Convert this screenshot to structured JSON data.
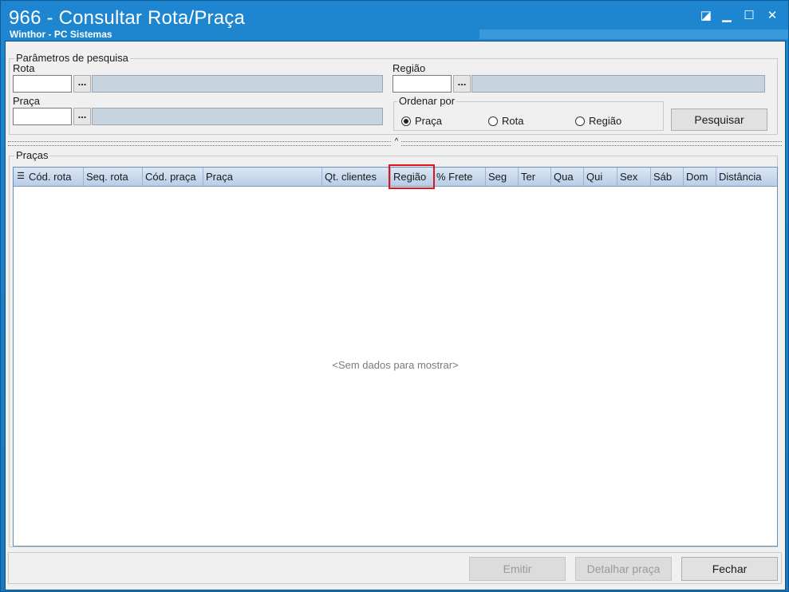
{
  "window": {
    "title": "966 - Consultar Rota/Praça",
    "subtitle": "Winthor - PC Sistemas",
    "controls": {
      "restore": "◪",
      "minimize": "▁",
      "maximize": "☐",
      "close": "✕"
    }
  },
  "search": {
    "group_title": "Parâmetros de pesquisa",
    "rota_label": "Rota",
    "rota_value": "",
    "praca_label": "Praça",
    "praca_value": "",
    "regiao_label": "Região",
    "regiao_value": "",
    "dots": "...",
    "order_title": "Ordenar por",
    "order_options": [
      "Praça",
      "Rota",
      "Região"
    ],
    "order_selected": "Praça",
    "search_button": "Pesquisar"
  },
  "grid": {
    "group_title": "Praças",
    "columns": [
      "Cód. rota",
      "Seq. rota",
      "Cód. praça",
      "Praça",
      "Qt. clientes",
      "Região",
      "% Frete",
      "Seg",
      "Ter",
      "Qua",
      "Qui",
      "Sex",
      "Sáb",
      "Dom",
      "Distância"
    ],
    "empty_text": "<Sem dados para mostrar>",
    "highlighted_column": "Região"
  },
  "footer": {
    "emitir": "Emitir",
    "detalhar": "Detalhar praça",
    "fechar": "Fechar"
  },
  "colors": {
    "title_bg": "#1e86d0",
    "highlight": "#e0141e"
  }
}
